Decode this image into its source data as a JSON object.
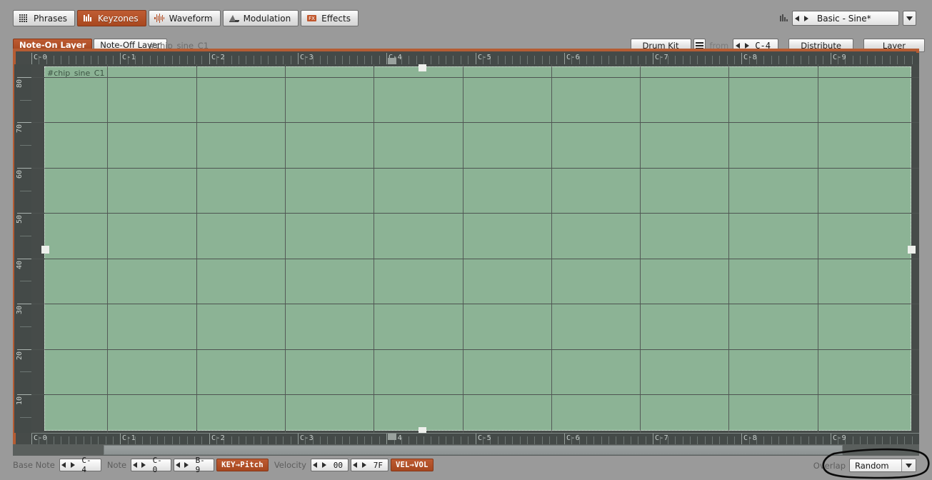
{
  "app": {
    "accent": "#a8481f",
    "zone_color": "#8cb395",
    "panel_bg": "#9a9a9a",
    "editor_bg": "#464b49"
  },
  "tabs": [
    {
      "label": "Phrases",
      "icon": "grid-icon",
      "active": false
    },
    {
      "label": "Keyzones",
      "icon": "keyzones-icon",
      "active": true
    },
    {
      "label": "Waveform",
      "icon": "waveform-icon",
      "active": false
    },
    {
      "label": "Modulation",
      "icon": "modulation-icon",
      "active": false
    },
    {
      "label": "Effects",
      "icon": "fx-icon",
      "active": false
    }
  ],
  "preset": {
    "icon": "vu-meter-icon",
    "value": "Basic - Sine*",
    "prev": "◀",
    "next": "▶",
    "dropdown": "▼"
  },
  "layer_row": {
    "note_on": "Note-On Layer",
    "note_off": "Note-Off Layer",
    "sample_name": "#chip_sine_C1",
    "drum_kit": "Drum Kit",
    "list_icon": "list-icon",
    "from_label": "from",
    "from_value": "C-4",
    "distribute": "Distribute",
    "layer": "Layer"
  },
  "editor": {
    "zone_label": "#chip_sine_C1",
    "octave_labels": [
      "C-0",
      "C-1",
      "C-2",
      "C-3",
      "C-4",
      "C-5",
      "C-6",
      "C-7",
      "C-8",
      "C-9"
    ],
    "velocity_labels": [
      "80",
      "70",
      "60",
      "50",
      "40",
      "30",
      "20",
      "10"
    ],
    "base_note_marker": "C-4",
    "handles": [
      "left-middle",
      "top-center",
      "bottom-center",
      "right-middle"
    ]
  },
  "bottom": {
    "base_note_label": "Base Note",
    "base_note_value": "C-4",
    "note_label": "Note",
    "note_low": "C-0",
    "note_high": "B-9",
    "key_to_pitch": "KEY→Pitch",
    "velocity_label": "Velocity",
    "velocity_low": "00",
    "velocity_high": "7F",
    "vel_to_vol": "VEL→VOL",
    "overlap_label": "Overlap",
    "overlap_value": "Random",
    "overlap_dropdown": "▼"
  }
}
